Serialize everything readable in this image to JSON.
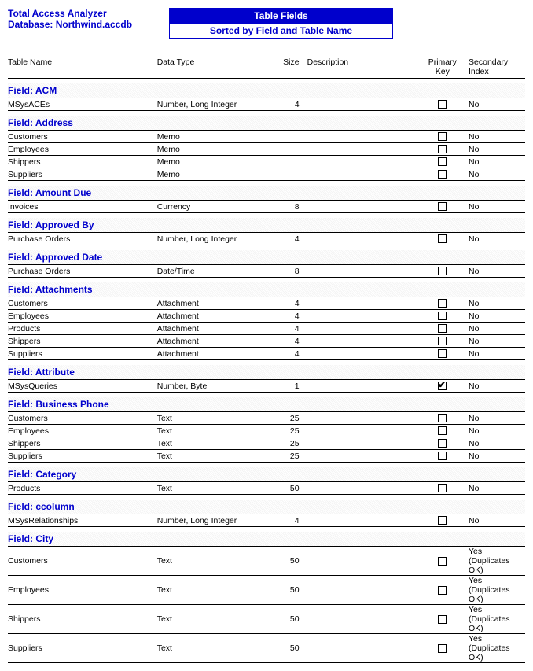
{
  "header": {
    "app_title": "Total Access Analyzer",
    "db_label_prefix": "Database: ",
    "db_name": "Northwind.accdb",
    "report_title": "Table Fields",
    "report_subtitle": "Sorted by Field and Table Name"
  },
  "columns": {
    "table": "Table Name",
    "type": "Data Type",
    "size": "Size",
    "desc": "Description",
    "pk": "Primary Key",
    "idx": "Secondary Index"
  },
  "groups": [
    {
      "title": "Field:  ACM",
      "rows": [
        {
          "table": "MSysACEs",
          "type": "Number, Long Integer",
          "size": "4",
          "desc": "",
          "pk": false,
          "idx": "No"
        }
      ]
    },
    {
      "title": "Field:  Address",
      "rows": [
        {
          "table": "Customers",
          "type": "Memo",
          "size": "",
          "desc": "",
          "pk": false,
          "idx": "No"
        },
        {
          "table": "Employees",
          "type": "Memo",
          "size": "",
          "desc": "",
          "pk": false,
          "idx": "No"
        },
        {
          "table": "Shippers",
          "type": "Memo",
          "size": "",
          "desc": "",
          "pk": false,
          "idx": "No"
        },
        {
          "table": "Suppliers",
          "type": "Memo",
          "size": "",
          "desc": "",
          "pk": false,
          "idx": "No"
        }
      ]
    },
    {
      "title": "Field:  Amount Due",
      "rows": [
        {
          "table": "Invoices",
          "type": "Currency",
          "size": "8",
          "desc": "",
          "pk": false,
          "idx": "No"
        }
      ]
    },
    {
      "title": "Field:  Approved By",
      "rows": [
        {
          "table": "Purchase Orders",
          "type": "Number, Long Integer",
          "size": "4",
          "desc": "",
          "pk": false,
          "idx": "No"
        }
      ]
    },
    {
      "title": "Field:  Approved Date",
      "rows": [
        {
          "table": "Purchase Orders",
          "type": "Date/Time",
          "size": "8",
          "desc": "",
          "pk": false,
          "idx": "No"
        }
      ]
    },
    {
      "title": "Field:  Attachments",
      "rows": [
        {
          "table": "Customers",
          "type": "Attachment",
          "size": "4",
          "desc": "",
          "pk": false,
          "idx": "No"
        },
        {
          "table": "Employees",
          "type": "Attachment",
          "size": "4",
          "desc": "",
          "pk": false,
          "idx": "No"
        },
        {
          "table": "Products",
          "type": "Attachment",
          "size": "4",
          "desc": "",
          "pk": false,
          "idx": "No"
        },
        {
          "table": "Shippers",
          "type": "Attachment",
          "size": "4",
          "desc": "",
          "pk": false,
          "idx": "No"
        },
        {
          "table": "Suppliers",
          "type": "Attachment",
          "size": "4",
          "desc": "",
          "pk": false,
          "idx": "No"
        }
      ]
    },
    {
      "title": "Field:  Attribute",
      "rows": [
        {
          "table": "MSysQueries",
          "type": "Number, Byte",
          "size": "1",
          "desc": "",
          "pk": true,
          "idx": "No"
        }
      ]
    },
    {
      "title": "Field:  Business Phone",
      "rows": [
        {
          "table": "Customers",
          "type": "Text",
          "size": "25",
          "desc": "",
          "pk": false,
          "idx": "No"
        },
        {
          "table": "Employees",
          "type": "Text",
          "size": "25",
          "desc": "",
          "pk": false,
          "idx": "No"
        },
        {
          "table": "Shippers",
          "type": "Text",
          "size": "25",
          "desc": "",
          "pk": false,
          "idx": "No"
        },
        {
          "table": "Suppliers",
          "type": "Text",
          "size": "25",
          "desc": "",
          "pk": false,
          "idx": "No"
        }
      ]
    },
    {
      "title": "Field:  Category",
      "rows": [
        {
          "table": "Products",
          "type": "Text",
          "size": "50",
          "desc": "",
          "pk": false,
          "idx": "No"
        }
      ]
    },
    {
      "title": "Field:  ccolumn",
      "rows": [
        {
          "table": "MSysRelationships",
          "type": "Number, Long Integer",
          "size": "4",
          "desc": "",
          "pk": false,
          "idx": "No"
        }
      ]
    },
    {
      "title": "Field:  City",
      "rows": [
        {
          "table": "Customers",
          "type": "Text",
          "size": "50",
          "desc": "",
          "pk": false,
          "idx": "Yes (Duplicates OK)"
        },
        {
          "table": "Employees",
          "type": "Text",
          "size": "50",
          "desc": "",
          "pk": false,
          "idx": "Yes (Duplicates OK)"
        },
        {
          "table": "Shippers",
          "type": "Text",
          "size": "50",
          "desc": "",
          "pk": false,
          "idx": "Yes (Duplicates OK)"
        },
        {
          "table": "Suppliers",
          "type": "Text",
          "size": "50",
          "desc": "",
          "pk": false,
          "idx": "Yes (Duplicates OK)"
        }
      ]
    }
  ]
}
